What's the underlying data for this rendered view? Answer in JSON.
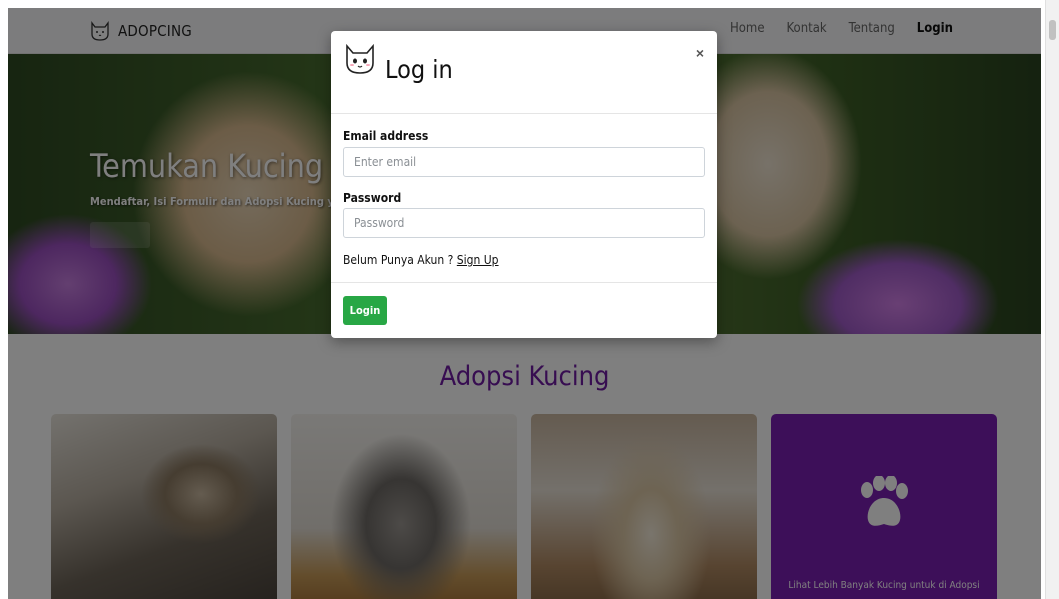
{
  "navbar": {
    "brand": "ADOPCING",
    "links": [
      {
        "label": "Home",
        "active": false
      },
      {
        "label": "Kontak",
        "active": false
      },
      {
        "label": "Tentang",
        "active": false
      },
      {
        "label": "Login",
        "active": true
      }
    ]
  },
  "hero": {
    "title": "Temukan Kucing ya",
    "subtitle": "Mendaftar, Isi Formulir dan Adopsi Kucing yang"
  },
  "section": {
    "title": "Adopsi Kucing"
  },
  "cards": [
    {
      "image": "tabby-cat-photo"
    },
    {
      "image": "gray-white-cat-photo"
    },
    {
      "image": "siamese-cat-photo"
    },
    {
      "icon": "paw-icon",
      "text": "Lihat Lebih Banyak Kucing untuk di Adopsi",
      "color": "#7b1fb3"
    }
  ],
  "modal": {
    "title": "Log in",
    "close_label": "×",
    "email_label": "Email address",
    "email_placeholder": "Enter email",
    "password_label": "Password",
    "password_placeholder": "Password",
    "signup_prefix": "Belum Punya Akun ? ",
    "signup_link": "Sign Up",
    "submit_label": "Login",
    "submit_color": "#28a745"
  },
  "colors": {
    "accent_purple": "#6f1aa3",
    "overlay": "rgba(0,0,0,0.5)"
  }
}
